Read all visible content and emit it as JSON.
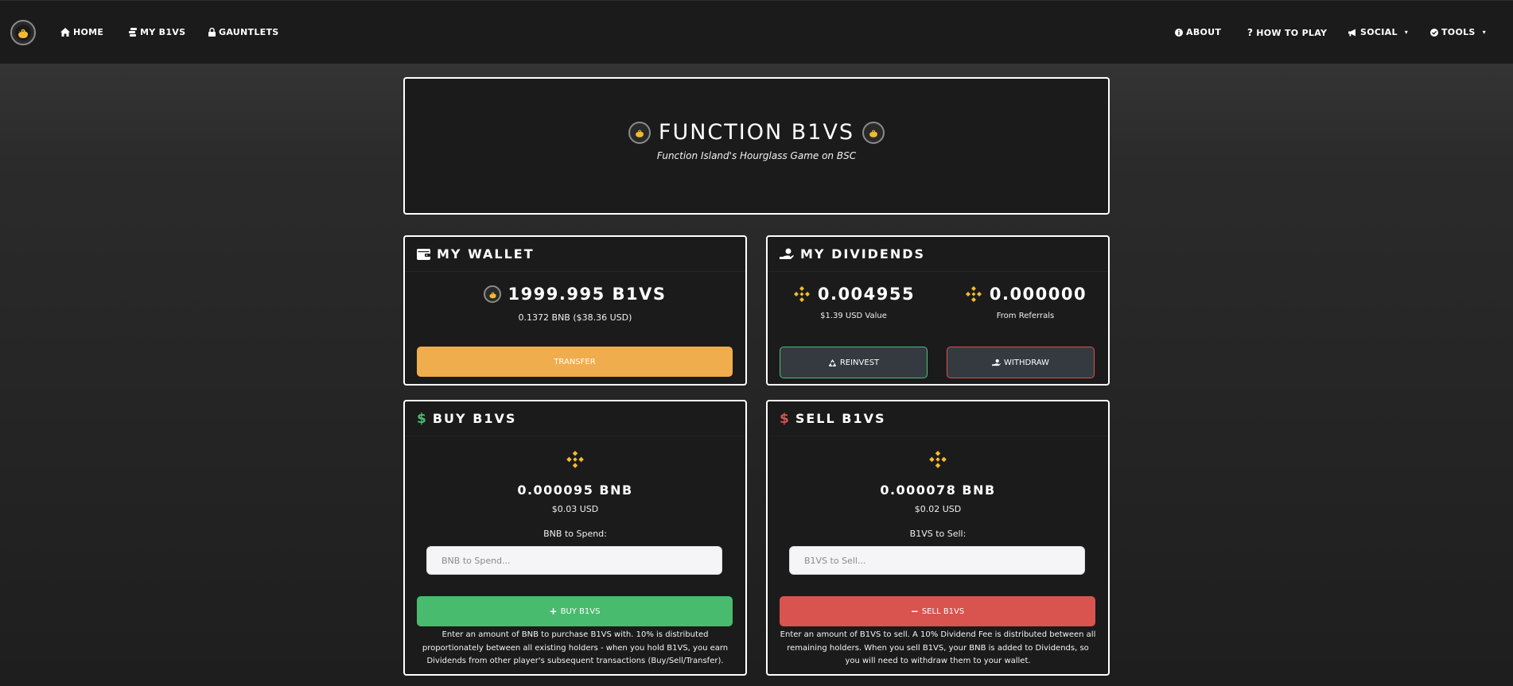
{
  "nav": {
    "left": [
      {
        "label": "HOME",
        "icon": "home-icon"
      },
      {
        "label": "MY B1VS",
        "icon": "coins-icon"
      },
      {
        "label": "GAUNTLETS",
        "icon": "lock-icon"
      }
    ],
    "right": [
      {
        "label": "ABOUT",
        "icon": "info-icon"
      },
      {
        "label": "HOW TO PLAY",
        "icon": "question-icon"
      },
      {
        "label": "SOCIAL",
        "icon": "megaphone-icon"
      },
      {
        "label": "TOOLS",
        "icon": "check-circle-icon"
      }
    ]
  },
  "hero": {
    "title": "FUNCTION B1VS",
    "subtitle": "Function Island's Hourglass Game on BSC"
  },
  "wallet": {
    "title": "MY WALLET",
    "balance": "1999.995 B1VS",
    "sub": "0.1372 BNB ($38.36 USD)",
    "transfer_label": "TRANSFER"
  },
  "dividends": {
    "title": "MY DIVIDENDS",
    "value": "0.004955",
    "value_sub": "$1.39 USD Value",
    "referrals": "0.000000",
    "referrals_sub": "From Referrals",
    "reinvest_label": "REINVEST",
    "withdraw_label": "WITHDRAW"
  },
  "buy": {
    "title": "BUY B1VS",
    "price": "0.000095 BNB",
    "price_usd": "$0.03 USD",
    "field_label": "BNB to Spend:",
    "placeholder": "BNB to Spend...",
    "button_label": "BUY B1VS",
    "description": "Enter an amount of BNB to purchase B1VS with. 10% is distributed proportionately between all existing holders - when you hold B1VS, you earn Dividends from other player's subsequent transactions (Buy/Sell/Transfer)."
  },
  "sell": {
    "title": "SELL B1VS",
    "price": "0.000078 BNB",
    "price_usd": "$0.02 USD",
    "field_label": "B1VS to Sell:",
    "placeholder": "B1VS to Sell...",
    "button_label": "SELL B1VS",
    "description": "Enter an amount of B1VS to sell. A 10% Dividend Fee is distributed between all remaining holders. When you sell B1VS, your BNB is added to Dividends, so you will need to withdraw them to your wallet."
  },
  "colors": {
    "accent_orange": "#f0ad4e",
    "bnb_gold": "#f3ba2f",
    "green": "#48bb6e",
    "red": "#d9534f"
  }
}
